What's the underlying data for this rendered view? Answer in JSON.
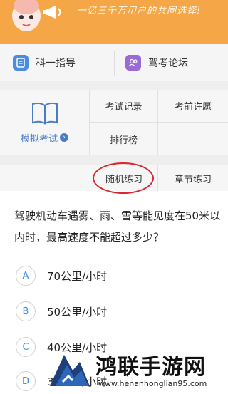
{
  "banner": {
    "slogan": "一亿三千万用户的共同选择!",
    "colors": {
      "background": "#f5a646"
    }
  },
  "menu": {
    "items": [
      {
        "label": "科一指导",
        "icon": "book-guide-icon"
      },
      {
        "label": "驾考论坛",
        "icon": "forum-users-icon"
      }
    ]
  },
  "grid": {
    "exam": {
      "label": "模拟考试",
      "icon": "open-book-icon"
    },
    "cells": [
      {
        "label": "考试记录"
      },
      {
        "label": "考前许愿"
      },
      {
        "label": "排行榜"
      }
    ]
  },
  "practice": {
    "items": [
      {
        "label": "随机练习"
      },
      {
        "label": "章节练习"
      }
    ],
    "highlight_color": "#d9272e"
  },
  "question": {
    "text": "驾驶机动车遇雾、雨、雪等能见度在50米以内时，最高速度不能超过多少？",
    "options": [
      {
        "key": "A",
        "text": "70公里/小时"
      },
      {
        "key": "B",
        "text": "50公里/小时"
      },
      {
        "key": "C",
        "text": "40公里/小时"
      },
      {
        "key": "D",
        "text": "30公里/小时"
      }
    ]
  },
  "watermark": {
    "title": "鸿联手游网",
    "url": "www.henanhonglian95.com"
  }
}
